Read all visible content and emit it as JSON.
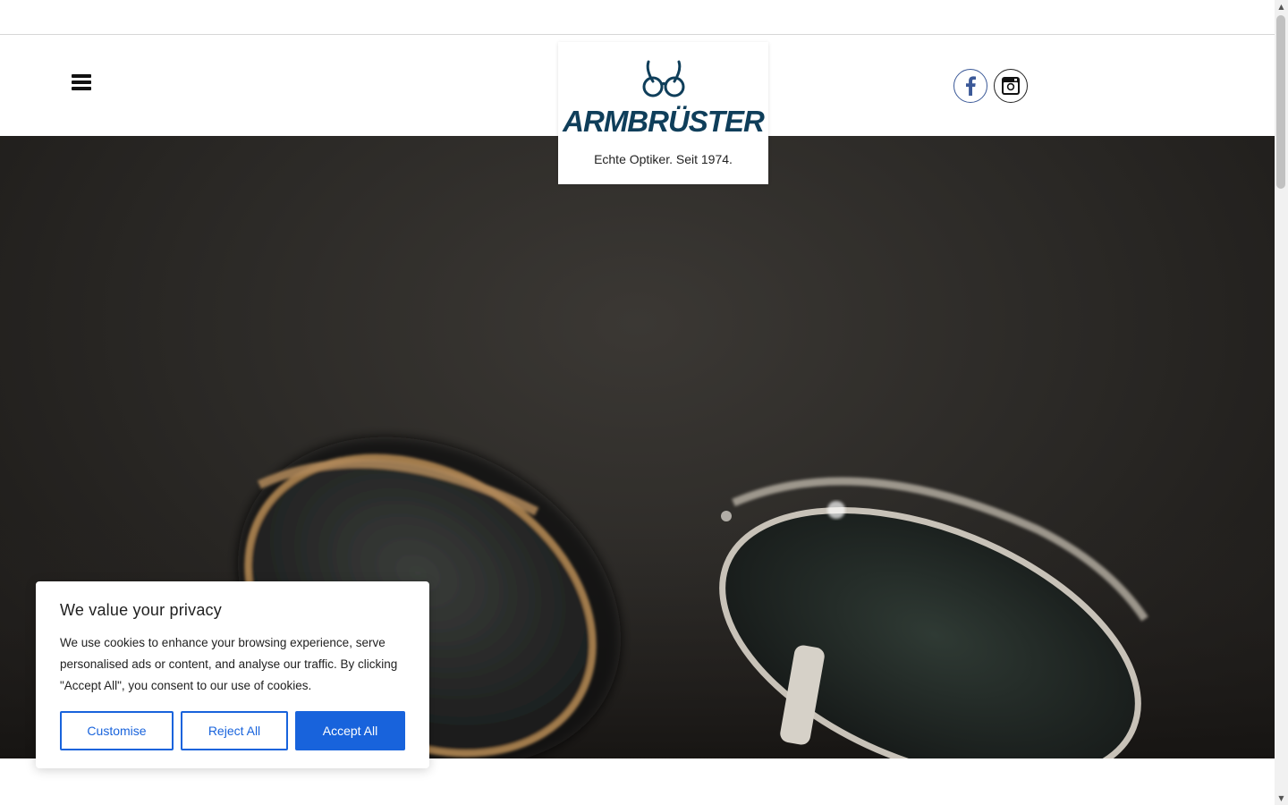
{
  "header": {
    "menu_icon": "hamburger-icon",
    "logo": {
      "brand": "ARMBRÜSTER",
      "tagline": "Echte Optiker. Seit 1974."
    },
    "social": [
      {
        "name": "Facebook",
        "icon": "facebook-icon"
      },
      {
        "name": "Instagram",
        "icon": "instagram-icon"
      }
    ]
  },
  "colors": {
    "brand": "#0f3e5a",
    "accent": "#1863dc",
    "facebook": "#3b5998"
  },
  "cookie_banner": {
    "title": "We value your privacy",
    "text": "We use cookies to enhance your browsing experience, serve personalised ads or content, and analyse our traffic. By clicking \"Accept All\", you consent to our use of cookies.",
    "buttons": {
      "customise": "Customise",
      "reject": "Reject All",
      "accept": "Accept All"
    }
  }
}
